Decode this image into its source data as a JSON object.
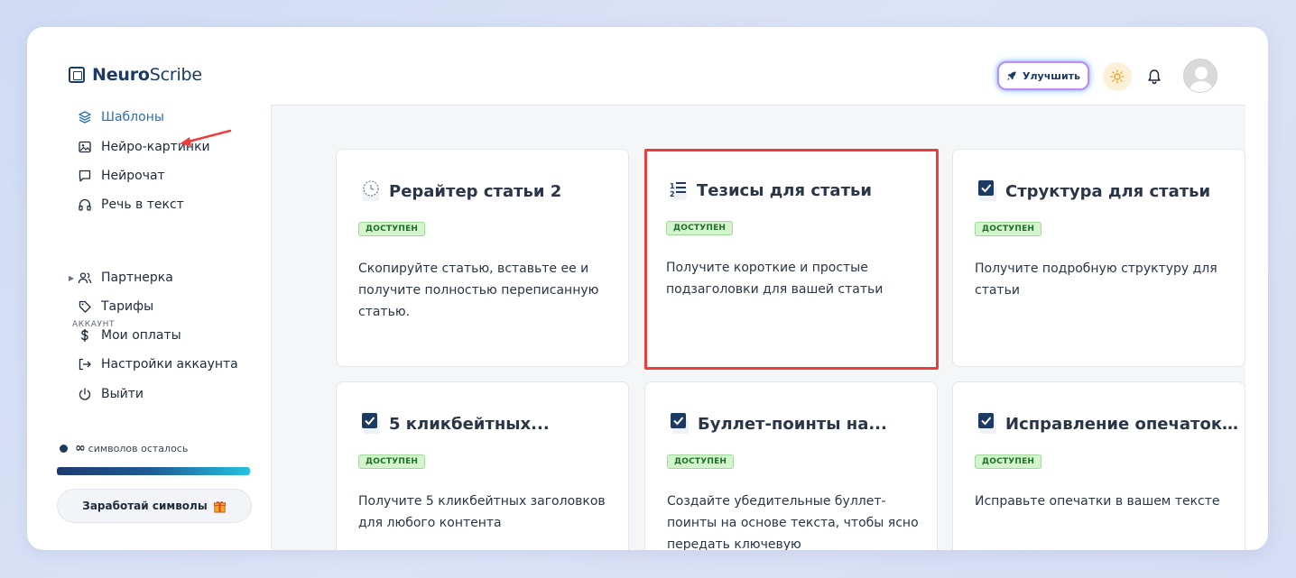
{
  "app": {
    "logo_bold": "Neuro",
    "logo_regular": "Scribe"
  },
  "header": {
    "upgrade_label": "Улучшить"
  },
  "sidebar": {
    "items": [
      {
        "label": "Шаблоны",
        "icon": "layers-icon",
        "active": true
      },
      {
        "label": "Нейро-картинки",
        "icon": "image-icon"
      },
      {
        "label": "Нейрочат",
        "icon": "chat-icon"
      },
      {
        "label": "Речь в текст",
        "icon": "headphones-icon"
      }
    ],
    "section_label": "АККАУНТ",
    "account_items": [
      {
        "label": "Партнерка",
        "icon": "users-icon"
      },
      {
        "label": "Тарифы",
        "icon": "tag-icon"
      },
      {
        "label": "Мои оплаты",
        "icon": "dollar-icon"
      },
      {
        "label": "Настройки аккаунта",
        "icon": "login-icon"
      },
      {
        "label": "Выйти",
        "icon": "power-icon"
      }
    ],
    "symbols_infinity": "∞",
    "symbols_label": "символов осталось",
    "earn_label": "Заработай символы"
  },
  "cards": [
    {
      "title": "Рерайтер статьи 2",
      "badge": "ДОСТУПЕН",
      "desc": "Скопируйте статью, вставьте ее и получите полностью переписанную статью."
    },
    {
      "title": "Тезисы для статьи",
      "badge": "ДОСТУПЕН",
      "desc": "Получите короткие и простые подзаголовки для вашей статьи"
    },
    {
      "title": "Структура для статьи",
      "badge": "ДОСТУПЕН",
      "desc": "Получите подробную структуру для статьи"
    },
    {
      "title": "5 кликбейтных...",
      "badge": "ДОСТУПЕН",
      "desc": "Получите 5 кликбейтных заголовков для любого контента"
    },
    {
      "title": "Буллет-поинты на...",
      "badge": "ДОСТУПЕН",
      "desc": "Создайте убедительные буллет-поинты на основе текста, чтобы ясно передать ключевую"
    },
    {
      "title": "Исправление опечаток...",
      "badge": "ДОСТУПЕН",
      "desc": "Исправьте опечатки в вашем тексте"
    }
  ],
  "colors": {
    "accent": "#2c6fb3",
    "highlight": "#ee3b3b",
    "badge_bg": "#d3f4cc"
  }
}
